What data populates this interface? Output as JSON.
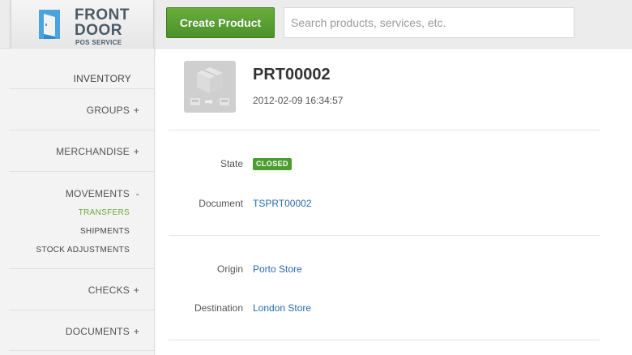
{
  "brand": {
    "line1": "FRONT",
    "line2": "DOOR",
    "tagline": "POS SERVICE",
    "accent": "#4aa3df"
  },
  "header": {
    "create_label": "Create Product",
    "search_placeholder": "Search products, services, etc."
  },
  "sidebar": {
    "inventory": "INVENTORY",
    "groups": {
      "label": "GROUPS",
      "sign": "+"
    },
    "merchandise": {
      "label": "MERCHANDISE",
      "sign": "+"
    },
    "movements": {
      "label": "MOVEMENTS",
      "sign": "-"
    },
    "sub_items": [
      "TRANSFERS",
      "SHIPMENTS",
      "STOCK ADJUSTMENTS"
    ],
    "active_sub": "TRANSFERS",
    "checks": {
      "label": "CHECKS",
      "sign": "+"
    },
    "documents": {
      "label": "DOCUMENTS",
      "sign": "+"
    }
  },
  "detail": {
    "title": "PRT00002",
    "datetime": "2012-02-09 16:34:57",
    "thumbnail_icon": "box-transfer-icon",
    "fields": {
      "state_label": "State",
      "state_value": "CLOSED",
      "document_label": "Document",
      "document_value": "TSPRT00002",
      "origin_label": "Origin",
      "origin_value": "Porto Store",
      "destination_label": "Destination",
      "destination_value": "London Store"
    }
  },
  "colors": {
    "primary_button": "#5a9f34",
    "link": "#2a6ab2",
    "active_nav": "#6aaa3d",
    "status_closed": "#4c9d2f"
  }
}
